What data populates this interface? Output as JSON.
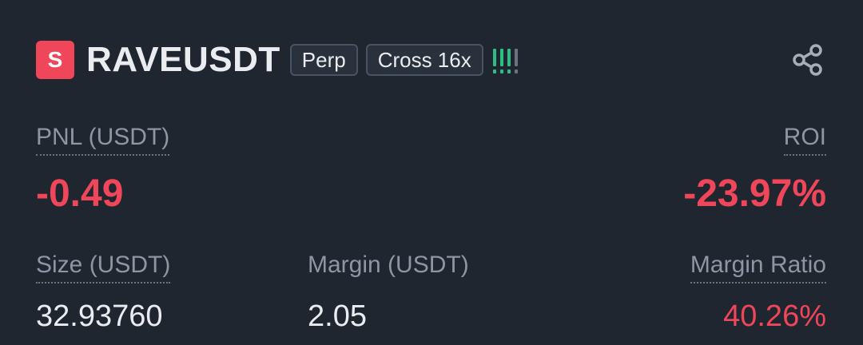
{
  "header": {
    "side_badge": "S",
    "symbol": "RAVEUSDT",
    "contract_type": "Perp",
    "margin_mode": "Cross 16x",
    "risk_level_icon": "signal-bars-icon",
    "share_icon": "share-icon"
  },
  "pnl": {
    "label": "PNL (USDT)",
    "value": "-0.49"
  },
  "roi": {
    "label": "ROI",
    "value": "-23.97%"
  },
  "size": {
    "label": "Size (USDT)",
    "value": "32.93760"
  },
  "margin": {
    "label": "Margin (USDT)",
    "value": "2.05"
  },
  "margin_ratio": {
    "label": "Margin Ratio",
    "value": "40.26%"
  },
  "colors": {
    "background": "#1f2630",
    "loss_red": "#f0465a",
    "risk_green": "#2ebd85",
    "label_gray": "#8d96a4",
    "text_white": "#eaecef"
  }
}
